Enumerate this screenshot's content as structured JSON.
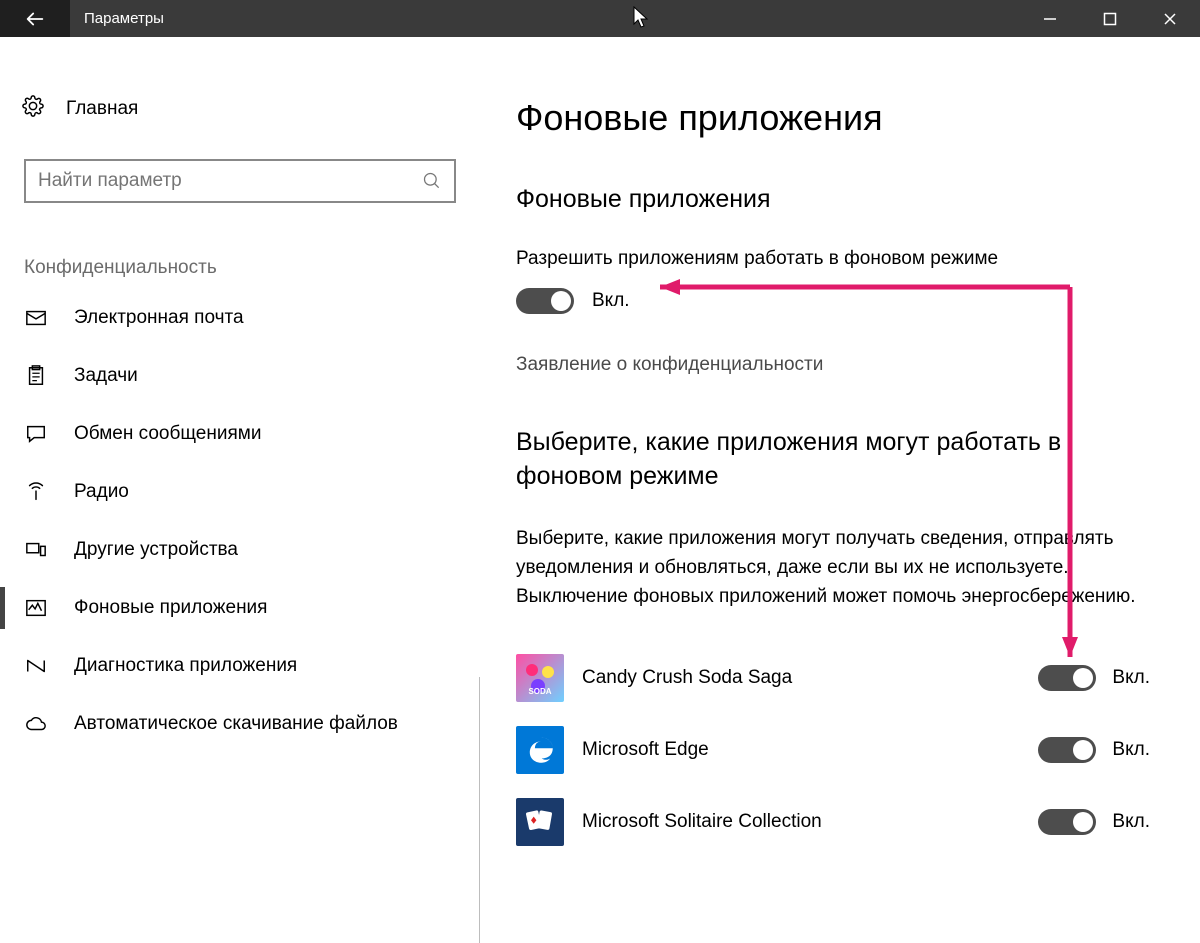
{
  "window": {
    "title": "Параметры"
  },
  "sidebar": {
    "home": "Главная",
    "search_placeholder": "Найти параметр",
    "section": "Конфиденциальность",
    "items": [
      {
        "icon": "mail",
        "label": "Электронная почта"
      },
      {
        "icon": "tasks",
        "label": "Задачи"
      },
      {
        "icon": "message",
        "label": "Обмен сообщениями"
      },
      {
        "icon": "radio",
        "label": "Радио"
      },
      {
        "icon": "devices",
        "label": "Другие устройства"
      },
      {
        "icon": "bgapps",
        "label": "Фоновые приложения",
        "selected": true
      },
      {
        "icon": "diag",
        "label": "Диагностика приложения"
      },
      {
        "icon": "cloud",
        "label": "Автоматическое скачивание файлов"
      }
    ]
  },
  "main": {
    "page_title": "Фоновые приложения",
    "section1_title": "Фоновые приложения",
    "master_label": "Разрешить приложениям работать в фоновом режиме",
    "master_state": "Вкл.",
    "privacy_link": "Заявление о конфиденциальности",
    "section2_title": "Выберите, какие приложения могут работать в фоновом режиме",
    "section2_desc": "Выберите, какие приложения могут получать сведения, отправлять уведомления и обновляться, даже если вы их не используете. Выключение фоновых приложений может помочь энергосбережению.",
    "apps": [
      {
        "name": "Candy Crush Soda Saga",
        "state": "Вкл.",
        "logo": "candy"
      },
      {
        "name": "Microsoft Edge",
        "state": "Вкл.",
        "logo": "edge"
      },
      {
        "name": "Microsoft Solitaire Collection",
        "state": "Вкл.",
        "logo": "solitaire"
      }
    ]
  }
}
